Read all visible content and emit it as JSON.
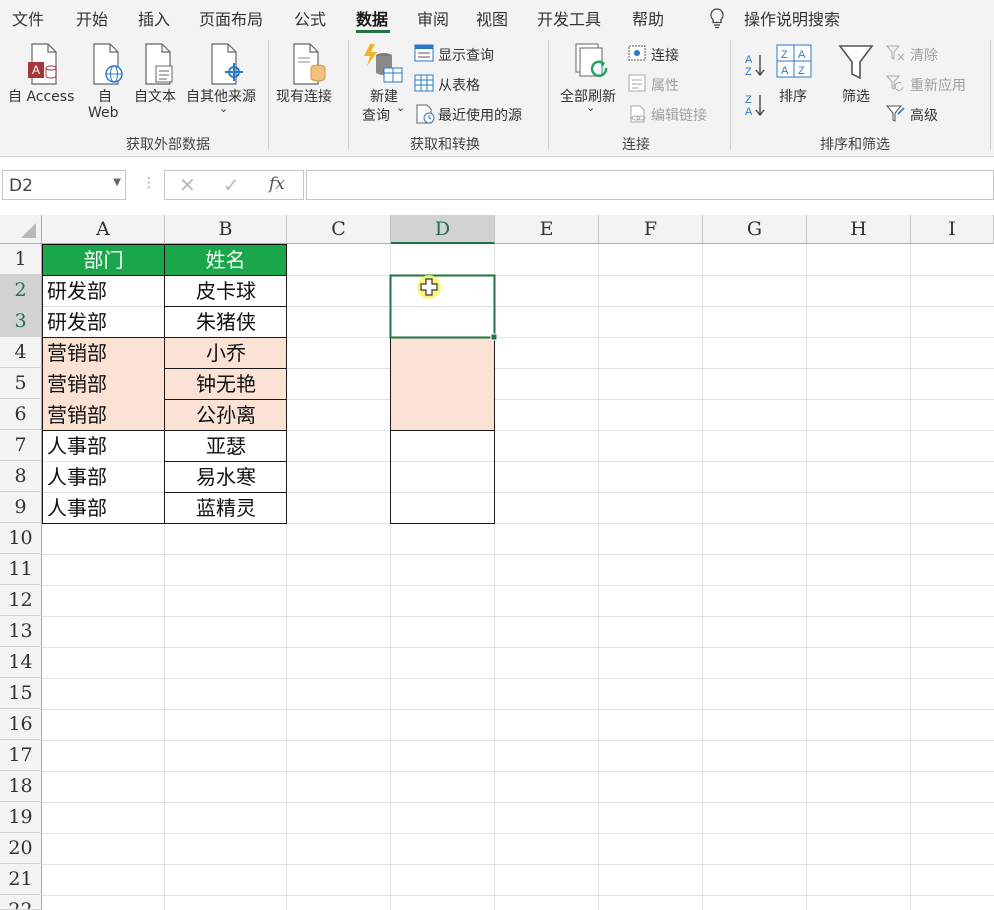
{
  "menu_tabs": [
    "文件",
    "开始",
    "插入",
    "页面布局",
    "公式",
    "数据",
    "审阅",
    "视图",
    "开发工具",
    "帮助"
  ],
  "active_tab": "数据",
  "tell_me": "操作说明搜索",
  "ribbon": {
    "get_external": {
      "group_label": "获取外部数据",
      "from_access": "自 Access",
      "from_web_1": "自",
      "from_web_2": "Web",
      "from_text": "自文本",
      "from_other": "自其他来源",
      "existing": "现有连接"
    },
    "get_transform": {
      "group_label": "获取和转换",
      "new_query_1": "新建",
      "new_query_2": "查询",
      "show_queries": "显示查询",
      "from_table": "从表格",
      "recent_sources": "最近使用的源"
    },
    "connections": {
      "group_label": "连接",
      "refresh_all": "全部刷新",
      "connections": "连接",
      "properties": "属性",
      "edit_links": "编辑链接"
    },
    "sort_filter": {
      "group_label": "排序和筛选",
      "sort": "排序",
      "filter": "筛选",
      "clear": "清除",
      "reapply": "重新应用",
      "advanced": "高级"
    }
  },
  "name_box": "D2",
  "fx_label": "fx",
  "formula": "",
  "columns": [
    "A",
    "B",
    "C",
    "D",
    "E",
    "F",
    "G",
    "H",
    "I"
  ],
  "rows": [
    "1",
    "2",
    "3",
    "4",
    "5",
    "6",
    "7",
    "8",
    "9",
    "10",
    "11",
    "12",
    "13",
    "14",
    "15",
    "16",
    "17",
    "18",
    "19",
    "20",
    "21",
    "22"
  ],
  "table": {
    "header": [
      "部门",
      "姓名"
    ],
    "rows": [
      [
        "研发部",
        "皮卡球"
      ],
      [
        "研发部",
        "朱猪侠"
      ],
      [
        "营销部",
        "小乔"
      ],
      [
        "营销部",
        "钟无艳"
      ],
      [
        "营销部",
        "公孙离"
      ],
      [
        "人事部",
        "亚瑟"
      ],
      [
        "人事部",
        "易水寒"
      ],
      [
        "人事部",
        "蓝精灵"
      ]
    ]
  },
  "colors": {
    "accent": "#217346",
    "header_fill": "#1aa64a",
    "band_fill": "#fbe2d5",
    "cursor_highlight": "#f7f46a"
  }
}
